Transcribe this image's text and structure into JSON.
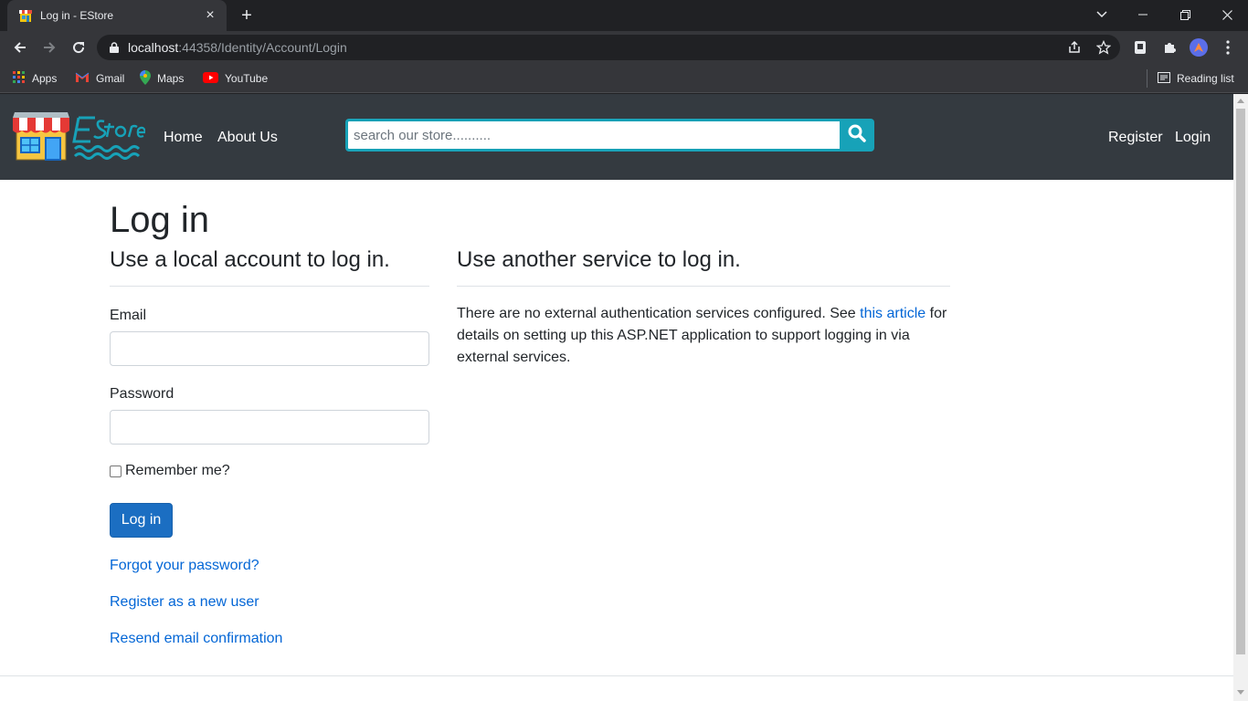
{
  "browser": {
    "tab_title": "Log in - EStore",
    "url_host": "localhost",
    "url_rest": ":44358/Identity/Account/Login",
    "bookmarks": [
      "Apps",
      "Gmail",
      "Maps",
      "YouTube"
    ],
    "reading_list": "Reading list"
  },
  "navbar": {
    "home": "Home",
    "about": "About Us",
    "search_placeholder": "search our store..........",
    "register": "Register",
    "login": "Login"
  },
  "main": {
    "title": "Log in",
    "local_heading": "Use a local account to log in.",
    "email_label": "Email",
    "password_label": "Password",
    "remember_label": "Remember me?",
    "login_button": "Log in",
    "forgot_link": "Forgot your password?",
    "register_link": "Register as a new user",
    "resend_link": "Resend email confirmation",
    "external_heading": "Use another service to log in.",
    "external_text_1": "There are no external authentication services configured. See ",
    "external_link": "this article",
    "external_text_2": " for details on setting up this ASP.NET application to support logging in via external services."
  },
  "colors": {
    "navbar_bg": "#343a40",
    "accent": "#17a2b8",
    "primary": "#1b6ec2",
    "link": "#0366d6"
  }
}
